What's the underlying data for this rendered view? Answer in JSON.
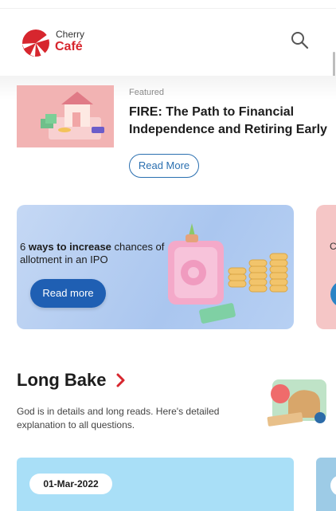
{
  "brand": {
    "name_top": "Cherry",
    "name_bottom": "Café",
    "colors": {
      "primary_red": "#d7262e",
      "accent_blue": "#1f5fb3"
    }
  },
  "header": {
    "search_icon": "search-icon"
  },
  "featured": {
    "label": "Featured",
    "title": "FIRE: The Path to Financial Independence and Retiring Early",
    "button_label": "Read More"
  },
  "carousel": {
    "items": [
      {
        "text_bold": "ways to increase",
        "text_prefix": "6 ",
        "text_suffix": " chances of allotment in an IPO",
        "button_label": "Read more"
      },
      {
        "text_partial": "C K"
      }
    ]
  },
  "long_bake": {
    "title": "Long Bake",
    "chevron_icon": "chevron-right-icon",
    "description": "God is in details and long reads. Here's detailed explanation to all questions."
  },
  "articles": {
    "items": [
      {
        "date": "01-Mar-2022"
      }
    ]
  }
}
